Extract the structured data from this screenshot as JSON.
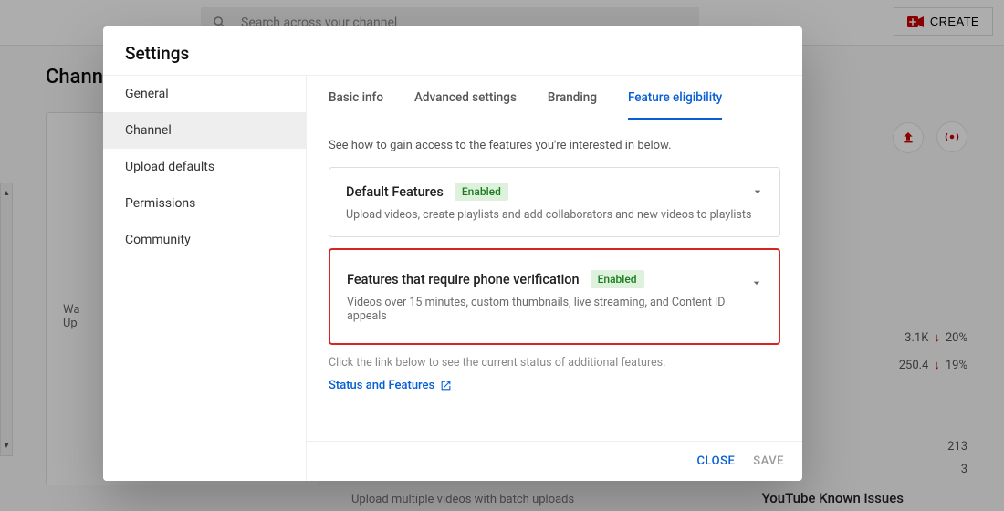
{
  "header": {
    "search_placeholder": "Search across your channel",
    "create_label": "CREATE"
  },
  "page": {
    "title_visible_fragment": "Channel",
    "left_card_line1": "Wa",
    "left_card_line2": "Up"
  },
  "right_rail": {
    "stat1": {
      "value": "3.1K",
      "delta_pct": "20%"
    },
    "stat2": {
      "value": "250.4",
      "delta_pct": "19%"
    },
    "plain1": "213",
    "plain2": "3"
  },
  "modal": {
    "title": "Settings",
    "sidebar": {
      "items": [
        {
          "label": "General"
        },
        {
          "label": "Channel"
        },
        {
          "label": "Upload defaults"
        },
        {
          "label": "Permissions"
        },
        {
          "label": "Community"
        }
      ]
    },
    "tabs": [
      {
        "label": "Basic info"
      },
      {
        "label": "Advanced settings"
      },
      {
        "label": "Branding"
      },
      {
        "label": "Feature eligibility"
      }
    ],
    "panel": {
      "intro": "See how to gain access to the features you're interested in below.",
      "cards": [
        {
          "title": "Default Features",
          "badge": "Enabled",
          "desc": "Upload videos, create playlists and add collaborators and new videos to playlists"
        },
        {
          "title": "Features that require phone verification",
          "badge": "Enabled",
          "desc": "Videos over 15 minutes, custom thumbnails, live streaming, and Content ID appeals"
        }
      ],
      "hint": "Click the link below to see the current status of additional features.",
      "link_label": "Status and Features"
    },
    "footer": {
      "close": "CLOSE",
      "save": "SAVE"
    }
  },
  "bottom": {
    "batch_text": "Upload multiple videos with batch uploads",
    "known_issues": "YouTube Known issues"
  }
}
